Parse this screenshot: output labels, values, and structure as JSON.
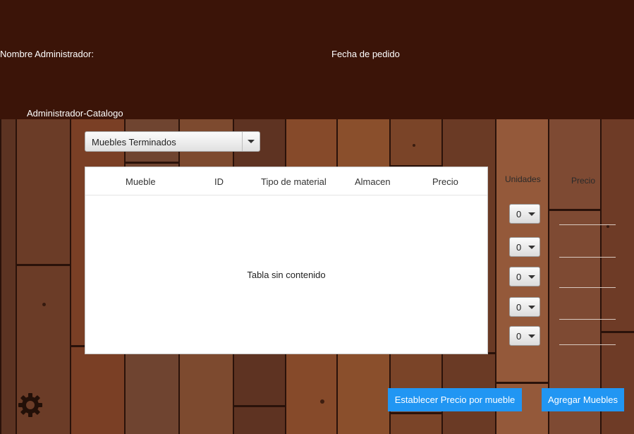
{
  "header": {
    "admin_label": "Nombre Administrador:",
    "date_label": "Fecha de pedido",
    "section_title": "Administrador-Catalogo"
  },
  "category_select": {
    "selected": "Muebles Terminados"
  },
  "table": {
    "columns": [
      "Mueble",
      "ID",
      "Tipo de material",
      "Almacen",
      "Precio"
    ],
    "empty_message": "Tabla sin contenido"
  },
  "side": {
    "units_label": "Unidades",
    "price_label": "Precio",
    "unit_values": [
      "0",
      "0",
      "0",
      "0",
      "0"
    ]
  },
  "buttons": {
    "set_price": "Establecer Precio por mueble",
    "add_furniture": "Agregar Muebles"
  },
  "icons": {
    "settings": "gear-icon"
  },
  "colors": {
    "header_bg": "#3b1408",
    "button_bg": "#2196f3"
  }
}
